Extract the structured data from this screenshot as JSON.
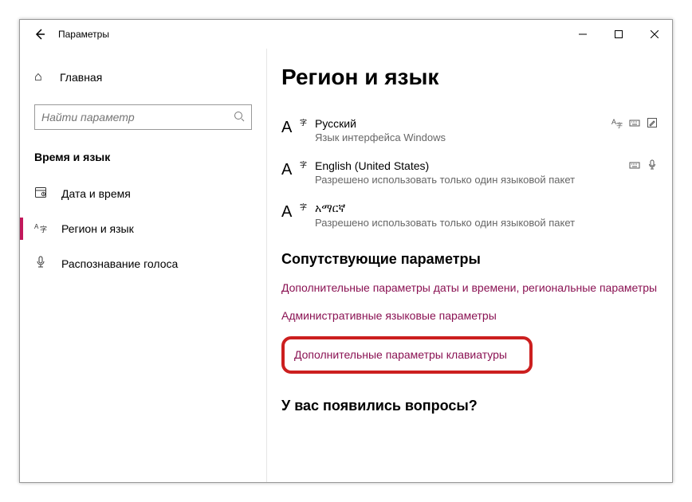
{
  "titlebar": {
    "title": "Параметры"
  },
  "sidebar": {
    "home": "Главная",
    "search_placeholder": "Найти параметр",
    "heading": "Время и язык",
    "items": [
      {
        "label": "Дата и время"
      },
      {
        "label": "Регион и язык"
      },
      {
        "label": "Распознавание голоса"
      }
    ]
  },
  "main": {
    "title": "Регион и язык",
    "languages": [
      {
        "name": "Русский",
        "desc": "Язык интерфейса Windows",
        "actions": 3
      },
      {
        "name": "English (United States)",
        "desc": "Разрешено использовать только один языковой пакет",
        "actions": 2
      },
      {
        "name": "አማርኛ",
        "desc": "Разрешено использовать только один языковой пакет",
        "actions": 0
      }
    ],
    "related_title": "Сопутствующие параметры",
    "links": [
      "Дополнительные параметры даты и времени, региональные параметры",
      "Административные языковые параметры",
      "Дополнительные параметры клавиатуры"
    ],
    "question_title": "У вас появились вопросы?"
  }
}
